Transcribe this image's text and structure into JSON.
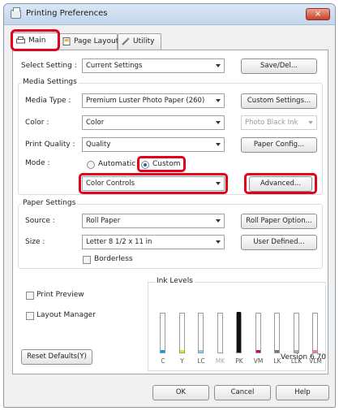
{
  "window": {
    "title": "Printing Preferences",
    "close_glyph": "×"
  },
  "tabs": [
    {
      "label": "Main",
      "icon": "printer-icon"
    },
    {
      "label": "Page Layout",
      "icon": "page-layout-icon"
    },
    {
      "label": "Utility",
      "icon": "utility-icon"
    }
  ],
  "select_setting": {
    "label": "Select Setting :",
    "value": "Current Settings",
    "button": "Save/Del..."
  },
  "media": {
    "group_title": "Media Settings",
    "type_label": "Media Type :",
    "type_value": "Premium Luster Photo Paper (260)",
    "custom_settings_button": "Custom Settings...",
    "color_label": "Color :",
    "color_value": "Color",
    "black_ink_value": "Photo Black Ink",
    "quality_label": "Print Quality :",
    "quality_value": "Quality",
    "paper_config_button": "Paper Config...",
    "mode_label": "Mode :",
    "mode_automatic": "Automatic",
    "mode_custom": "Custom",
    "mode_selected": "Custom",
    "mode_value": "Color Controls",
    "advanced_button": "Advanced..."
  },
  "paper": {
    "group_title": "Paper Settings",
    "source_label": "Source :",
    "source_value": "Roll Paper",
    "roll_option_button": "Roll Paper Option...",
    "size_label": "Size :",
    "size_value": "Letter 8 1/2 x 11 in",
    "user_defined_button": "User Defined...",
    "borderless_label": "Borderless",
    "borderless_checked": false
  },
  "print_preview": {
    "label": "Print Preview",
    "checked": false
  },
  "layout_manager": {
    "label": "Layout Manager",
    "checked": false
  },
  "ink_levels": {
    "title": "Ink Levels",
    "inks": [
      {
        "name": "C",
        "level": 0.05,
        "color": "#00a0e0",
        "active": true
      },
      {
        "name": "Y",
        "level": 0.05,
        "color": "#f5e200",
        "active": true
      },
      {
        "name": "LC",
        "level": 0.05,
        "color": "#7fd0f0",
        "active": true
      },
      {
        "name": "MK",
        "level": 0.0,
        "color": "#bbbbbb",
        "active": false
      },
      {
        "name": "PK",
        "level": 1.0,
        "color": "#111111",
        "active": true
      },
      {
        "name": "VM",
        "level": 0.05,
        "color": "#d0007a",
        "active": true
      },
      {
        "name": "LK",
        "level": 0.05,
        "color": "#777777",
        "active": true
      },
      {
        "name": "LLK",
        "level": 0.05,
        "color": "#aaaaaa",
        "active": true
      },
      {
        "name": "VLM",
        "level": 0.05,
        "color": "#ff6fc0",
        "active": true
      }
    ]
  },
  "reset_button": "Reset Defaults(Y)",
  "version": "Version 6.70",
  "footer": {
    "ok": "OK",
    "cancel": "Cancel",
    "help": "Help"
  },
  "colors": {
    "highlight": "#e3001b"
  }
}
